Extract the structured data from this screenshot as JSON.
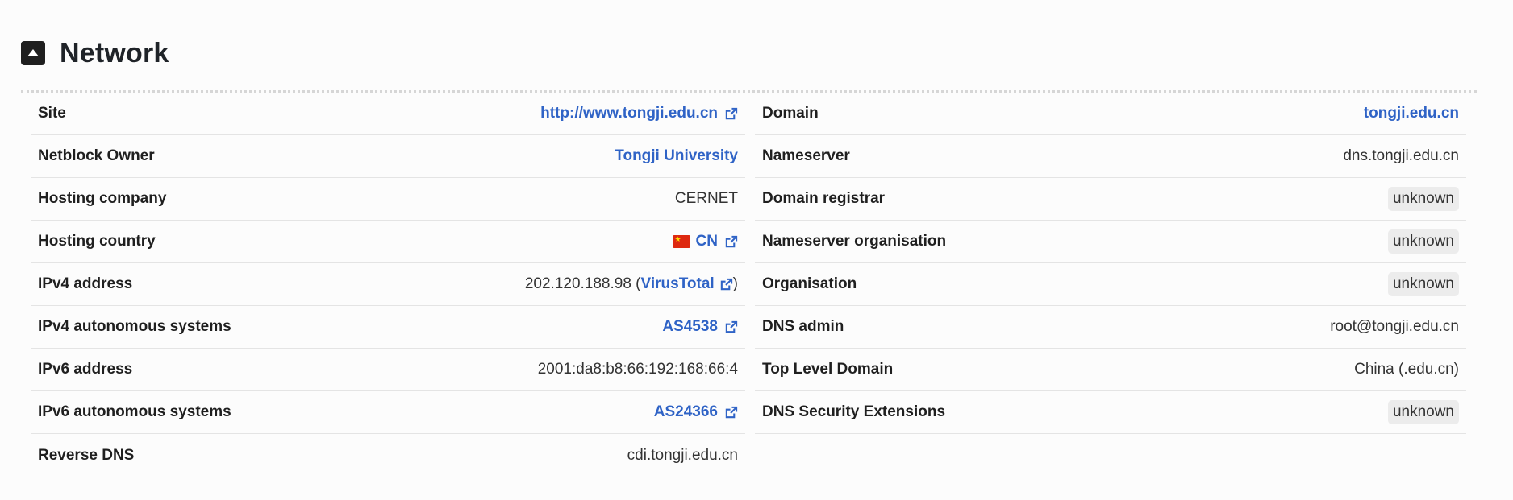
{
  "section": {
    "title": "Network"
  },
  "left_rows": [
    {
      "label": "Site",
      "value": "http://www.tongji.edu.cn",
      "type": "link-ext"
    },
    {
      "label": "Netblock Owner",
      "value": "Tongji University",
      "type": "link"
    },
    {
      "label": "Hosting company",
      "value": "CERNET",
      "type": "text"
    },
    {
      "label": "Hosting country",
      "value": "CN",
      "type": "flag-link-ext",
      "flag": "china-flag-icon"
    },
    {
      "label": "IPv4 address",
      "value": "202.120.188.98",
      "link": "VirusTotal",
      "type": "text-link"
    },
    {
      "label": "IPv4 autonomous systems",
      "value": "AS4538",
      "type": "link-ext"
    },
    {
      "label": "IPv6 address",
      "value": "2001:da8:b8:66:192:168:66:4",
      "type": "text"
    },
    {
      "label": "IPv6 autonomous systems",
      "value": "AS24366",
      "type": "link-ext"
    },
    {
      "label": "Reverse DNS",
      "value": "cdi.tongji.edu.cn",
      "type": "text"
    }
  ],
  "right_rows": [
    {
      "label": "Domain",
      "value": "tongji.edu.cn",
      "type": "link"
    },
    {
      "label": "Nameserver",
      "value": "dns.tongji.edu.cn",
      "type": "text"
    },
    {
      "label": "Domain registrar",
      "value": "unknown",
      "type": "badge"
    },
    {
      "label": "Nameserver organisation",
      "value": "unknown",
      "type": "badge"
    },
    {
      "label": "Organisation",
      "value": "unknown",
      "type": "badge"
    },
    {
      "label": "DNS admin",
      "value": "root@tongji.edu.cn",
      "type": "text"
    },
    {
      "label": "Top Level Domain",
      "value": "China (.edu.cn)",
      "type": "text"
    },
    {
      "label": "DNS Security Extensions",
      "value": "unknown",
      "type": "badge"
    }
  ],
  "colors": {
    "link": "#2f63c6",
    "label": "#1f1f1f",
    "badge_bg": "#ececec",
    "divider": "#d6d6d6"
  }
}
